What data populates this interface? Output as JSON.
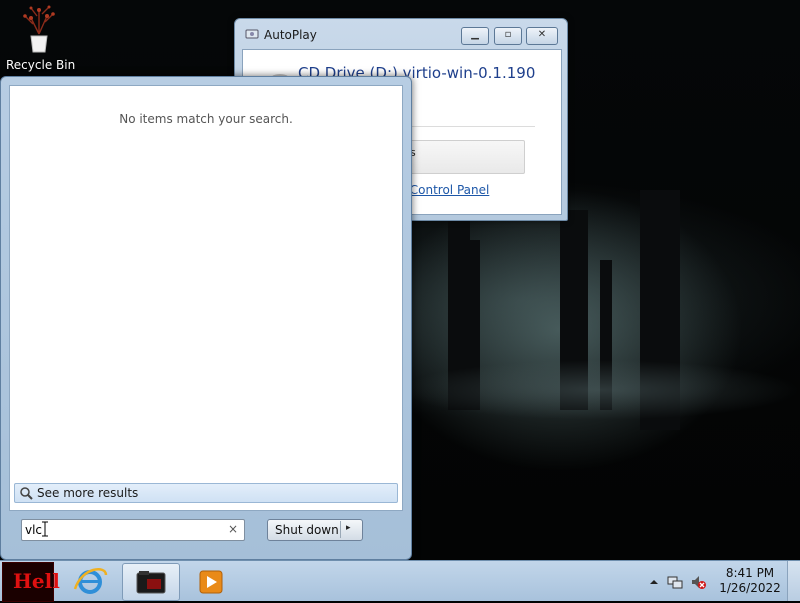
{
  "desktop": {
    "icons": [
      {
        "label": "Recycle Bin"
      }
    ]
  },
  "autoplay": {
    "title": "AutoPlay",
    "drive_label": "CD Drive (D:) virtio-win-0.1.190",
    "option_label": "s",
    "link_text": "in Control Panel"
  },
  "start_menu": {
    "no_items_text": "No items match your search.",
    "see_more_label": "See more results",
    "search_value": "vlc",
    "clear_glyph": "×",
    "shutdown_label": "Shut down",
    "shutdown_arrow": "▸"
  },
  "taskbar": {
    "start_text": "Hell",
    "time": "8:41 PM",
    "date": "1/26/2022"
  },
  "colors": {
    "link": "#1d57a8",
    "drive_title": "#1e3f8c",
    "start_orb_red": "#e01010"
  }
}
